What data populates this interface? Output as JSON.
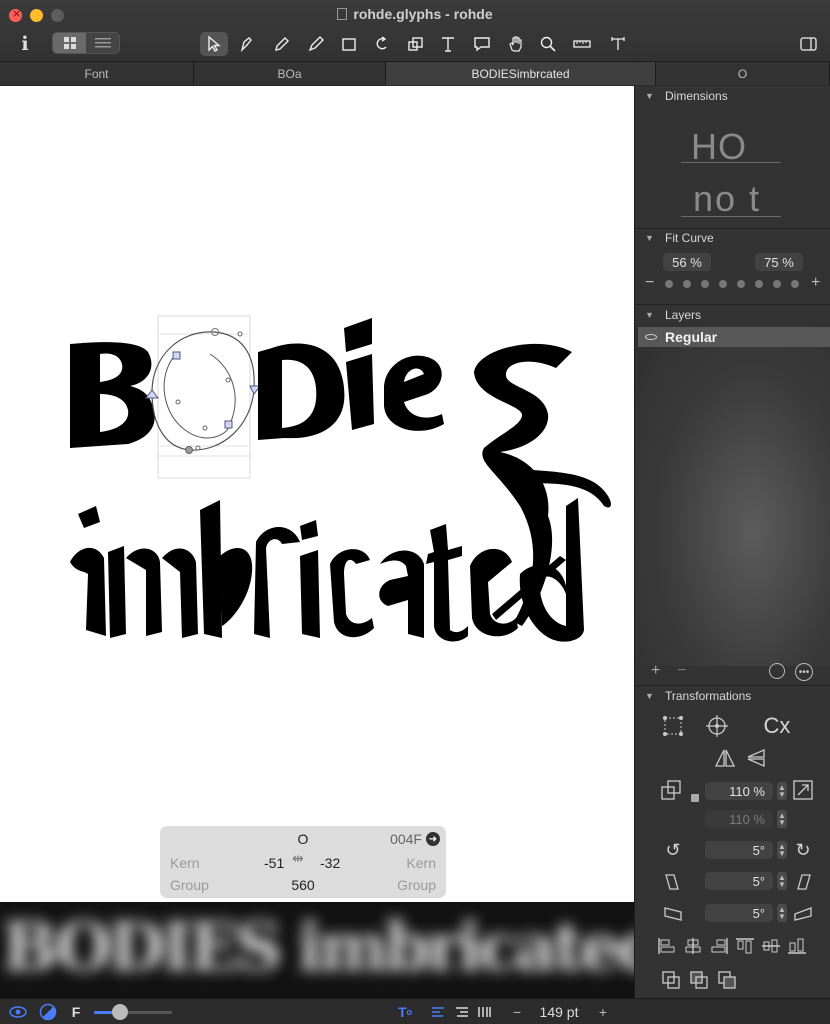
{
  "window": {
    "title": "rohde.glyphs - rohde"
  },
  "tabs": [
    {
      "label": "Font"
    },
    {
      "label": "BOa"
    },
    {
      "label": "BODIESimbrcated"
    },
    {
      "label": "O"
    }
  ],
  "canvas": {
    "line1": "BODies",
    "line2": "imbricated"
  },
  "infobox": {
    "glyph_name": "O",
    "unicode": "004F",
    "kern_label_left": "Kern",
    "kern_left": "-51",
    "kern_right": "-32",
    "kern_label_right": "Kern",
    "group_label_left": "Group",
    "width": "560",
    "group_label_right": "Group"
  },
  "preview": {
    "text": "BODIES imbricated"
  },
  "bottombar": {
    "font_indicator": "F",
    "size": "149 pt"
  },
  "sidebar": {
    "dimensions": {
      "title": "Dimensions",
      "sample_top": "HO",
      "sample_bottom": "no t"
    },
    "fit_curve": {
      "title": "Fit Curve",
      "value_left": "56 %",
      "value_right": "75 %"
    },
    "layers": {
      "title": "Layers",
      "items": [
        {
          "name": "Regular"
        }
      ]
    },
    "transformations": {
      "title": "Transformations",
      "scale": "110 %",
      "scale_secondary": "110 %",
      "rotate": "5°",
      "slant": "5°",
      "skew": "5°"
    }
  },
  "colors": {
    "accent": "#4a7cff",
    "canvas_bg": "#ffffff",
    "panel_bg": "#333333"
  }
}
